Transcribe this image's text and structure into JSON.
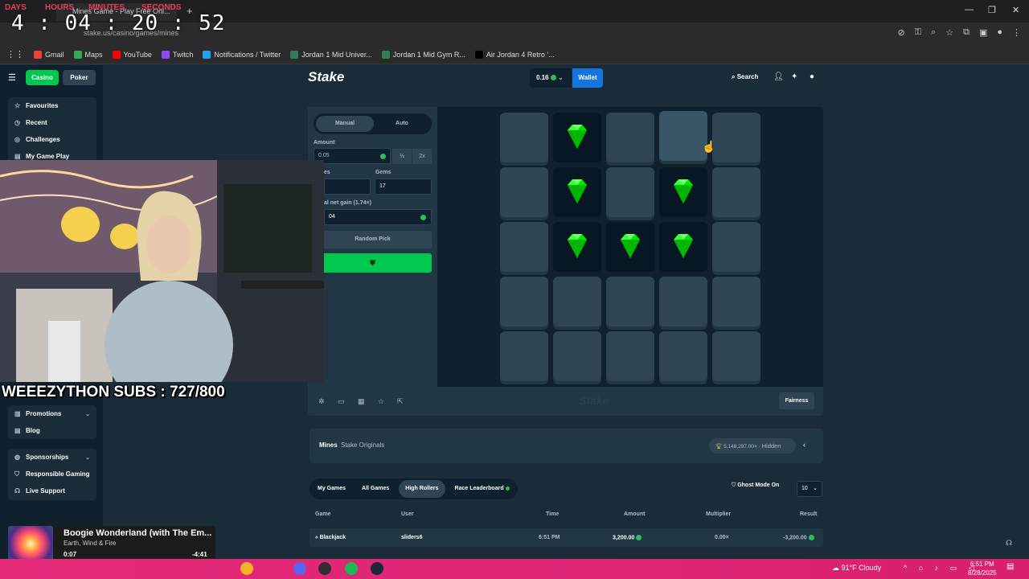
{
  "browser": {
    "tab_title": "Mines Game - Play Free Onl...",
    "url": "stake.us/casino/games/mines",
    "bookmarks": [
      "Gmail",
      "Maps",
      "YouTube",
      "Twitch",
      "Notifications / Twitter",
      "Jordan 1 Mid Univer...",
      "Jordan 1 Mid Gym R...",
      "Air Jordan 4 Retro '..."
    ]
  },
  "overlay": {
    "timer_labels": [
      "DAYS",
      "HOURS",
      "MINUTES",
      "SECONDS"
    ],
    "timer": "4 : 04 : 20 : 52",
    "subs": "WEEEZYTHON SUBS : 727/800"
  },
  "sidebar": {
    "casino": "Casino",
    "poker": "Poker",
    "top_items": [
      "Favourites",
      "Recent",
      "Challenges",
      "My Game Play"
    ],
    "bottom_items": [
      {
        "label": "Promotions",
        "chevron": true
      },
      {
        "label": "Blog",
        "chevron": false
      }
    ],
    "footer_items": [
      {
        "label": "Sponsorships",
        "chevron": true
      },
      {
        "label": "Responsible Gaming",
        "chevron": false
      },
      {
        "label": "Live Support",
        "chevron": false
      }
    ]
  },
  "topbar": {
    "logo": "Stake",
    "balance": "0.16",
    "wallet": "Wallet",
    "search": "Search"
  },
  "controls": {
    "manual": "Manual",
    "auto": "Auto",
    "amount_label": "Amount",
    "amount_value": "0.05",
    "half": "½",
    "double": "2x",
    "mines_label": "es",
    "gems_label": "Gems",
    "gems_value": "17",
    "gain_label": "al net gain (1.74×)",
    "gain_value": "04",
    "random_pick": "Random Pick"
  },
  "board": {
    "gems": [
      [
        0,
        1
      ],
      [
        1,
        1
      ],
      [
        1,
        3
      ],
      [
        2,
        1
      ],
      [
        2,
        2
      ],
      [
        2,
        3
      ]
    ],
    "hover": [
      0,
      3
    ],
    "colors": {
      "gem": "#00e701",
      "tile": "#2f4553"
    }
  },
  "game_footer": {
    "fairness": "Fairness",
    "watermark": "Stake"
  },
  "info": {
    "title": "Mines",
    "subtitle": "Stake Originals",
    "wagered": "5,148,297.00×",
    "hidden": "Hidden"
  },
  "bets": {
    "tabs": [
      "My Games",
      "All Games",
      "High Rollers",
      "Race Leaderboard"
    ],
    "active_tab": "High Rollers",
    "ghost_mode": "Ghost Mode On",
    "rows_count": "10",
    "headers": [
      "Game",
      "User",
      "Time",
      "Amount",
      "Multiplier",
      "Result"
    ],
    "rows": [
      {
        "game": "Blackjack",
        "user": "sliders6",
        "time": "6:51 PM",
        "amount": "3,200.00",
        "multiplier": "0.00×",
        "result": "-3,200.00"
      }
    ]
  },
  "music": {
    "song": "Boogie Wonderland (with The Em...",
    "artist": "Earth, Wind & Fire",
    "elapsed": "0:07",
    "remaining": "-4:41"
  },
  "taskbar": {
    "weather": "91°F  Cloudy",
    "time": "6:51 PM",
    "date": "8/28/2025"
  }
}
